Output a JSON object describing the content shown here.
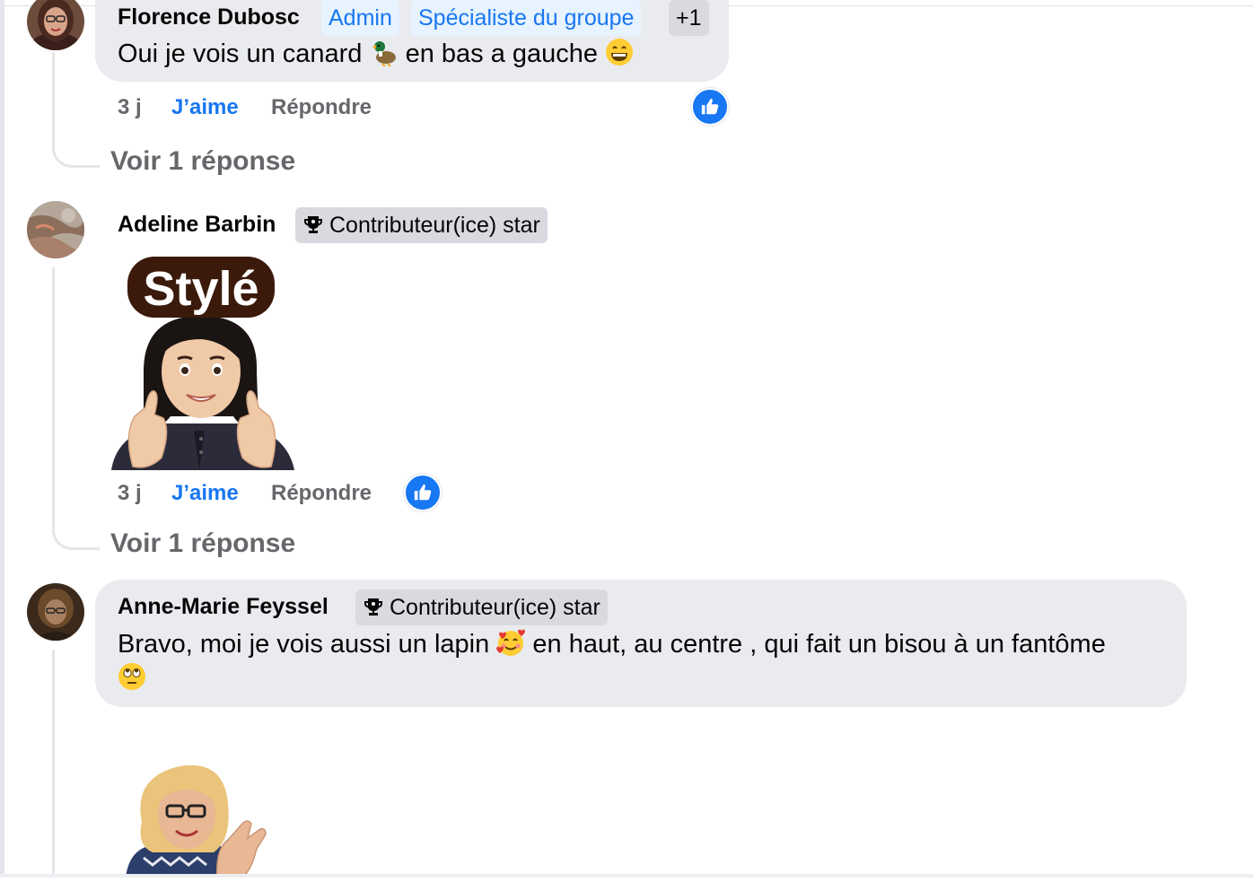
{
  "comments": [
    {
      "author": "Florence Dubosc",
      "badges": [
        "Admin",
        "Spécialiste du groupe"
      ],
      "badge_more": "+1",
      "text_before": "Oui je vois un canard",
      "text_emoji_1": "duck-emoji",
      "text_middle": "en bas a gauche",
      "text_emoji_2": "grinning-emoji",
      "time": "3 j",
      "like_label": "J’aime",
      "reply_label": "Répondre",
      "view_replies": "Voir 1 réponse"
    },
    {
      "author": "Adeline Barbin",
      "badge": "Contributeur(ice) star",
      "sticker_text": "Stylé",
      "time": "3 j",
      "like_label": "J’aime",
      "reply_label": "Répondre",
      "view_replies": "Voir 1 réponse"
    },
    {
      "author": "Anne-Marie Feyssel",
      "badge": "Contributeur(ice) star",
      "text_before": "Bravo, moi je vois aussi un lapin",
      "text_emoji_1": "smiling-face-with-hearts-emoji",
      "text_middle": "en haut, au centre , qui fait un bisou à un fantôme",
      "text_emoji_2": "rolling-eyes-emoji"
    }
  ],
  "colors": {
    "accent": "#1877f2",
    "bubble": "#e9ebee",
    "muted": "#65676b"
  }
}
